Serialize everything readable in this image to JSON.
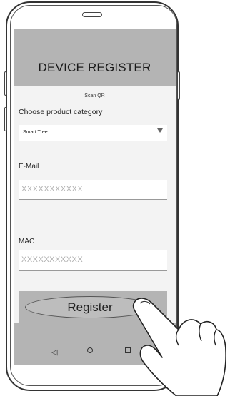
{
  "header": {
    "title": "DEVICE REGISTER"
  },
  "scan_qr": "Scan QR",
  "category": {
    "label": "Choose product category",
    "selected": "Smart Tree"
  },
  "email": {
    "label": "E-Mail",
    "placeholder": "XXXXXXXXXXX"
  },
  "mac": {
    "label": "MAC",
    "placeholder": "XXXXXXXXXXX"
  },
  "register": {
    "label": "Register"
  },
  "navbar": {
    "icons": [
      "back-triangle-icon",
      "home-circle-icon",
      "recent-square-icon"
    ]
  }
}
